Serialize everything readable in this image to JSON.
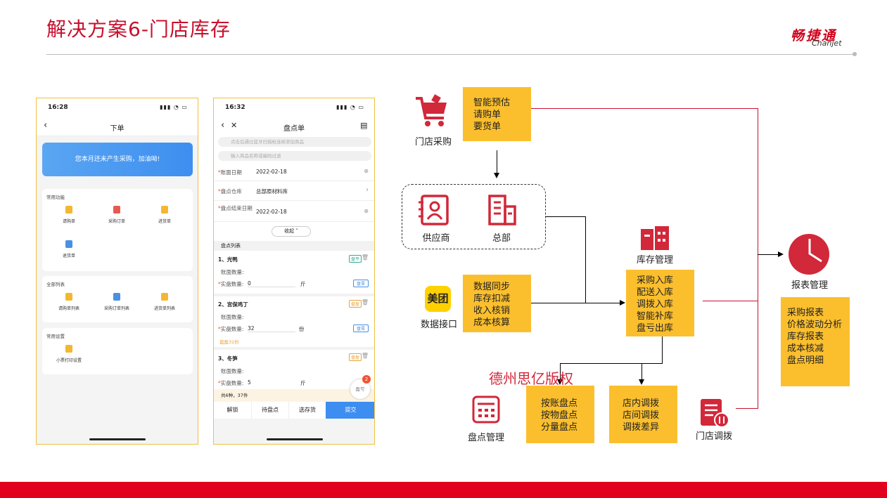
{
  "slide": {
    "title": "解决方案6-门店库存",
    "logo_cn": "畅捷通",
    "logo_en": "Chanjet",
    "watermark": "德州思亿版权"
  },
  "phone1": {
    "time": "16:28",
    "nav_title": "下单",
    "banner": "您本月还未产生采购，加油呦!",
    "sections": [
      {
        "title": "常用功能",
        "items": [
          "请购单",
          "采购订单",
          "进货单",
          "退货单"
        ]
      },
      {
        "title": "全部列表",
        "items": [
          "请购单列表",
          "采购订单列表",
          "进货单列表"
        ]
      },
      {
        "title": "常用设置",
        "items": [
          "小票打印设置"
        ]
      }
    ]
  },
  "phone2": {
    "time": "16:32",
    "nav_title": "盘点单",
    "search1": "点击后通过蓝牙扫描枪连续添加商品",
    "search2": "输入商品名称或编码过滤",
    "fields": [
      {
        "label": "账面日期",
        "value": "2022-02-18"
      },
      {
        "label": "盘点仓库",
        "value": "总部原材料库"
      },
      {
        "label": "盘点结束日期",
        "value": "2022-02-18"
      }
    ],
    "collapse": "收起",
    "list_title": "盘点列表",
    "items": [
      {
        "name": "1、光鸭",
        "book_label": "账面数量:",
        "actual_label": "实盘数量:",
        "actual": "0",
        "unit": "斤",
        "tag": "盘平",
        "btn": "盘零"
      },
      {
        "name": "2、宫保鸡丁",
        "book_label": "账面数量:",
        "actual_label": "实盘数量:",
        "actual": "32",
        "unit": "份",
        "tag": "盘盈",
        "btn": "盘零",
        "note": "盘盈32份"
      },
      {
        "name": "3、冬笋",
        "book_label": "账面数量:",
        "actual_label": "实盘数量:",
        "actual": "5",
        "unit": "斤",
        "tag": "盘盈"
      }
    ],
    "summary": "共6种，37件",
    "float_label": "盈亏",
    "badge": "2",
    "buttons": [
      "解锁",
      "待盘点",
      "选存货",
      "提交"
    ]
  },
  "diagram": {
    "store_purchase": {
      "label": "门店采购",
      "lines": [
        "智能预估",
        "请购单",
        "要货单"
      ]
    },
    "supplier": "供应商",
    "hq": "总部",
    "data_interface": {
      "label": "数据接口",
      "logo": "美团",
      "lines": [
        "数据同步",
        "库存扣减",
        "收入核销",
        "成本核算"
      ]
    },
    "inventory": {
      "label": "库存管理",
      "lines": [
        "采购入库",
        "配送入库",
        "调拨入库",
        "智能补库",
        "盘亏出库"
      ]
    },
    "report": {
      "label": "报表管理",
      "lines": [
        "采购报表",
        "价格波动分析",
        "库存报表",
        "成本核减",
        "盘点明细"
      ]
    },
    "stocktake": {
      "label": "盘点管理",
      "lines": [
        "按账盘点",
        "按物盘点",
        "分量盘点"
      ]
    },
    "transfer_box": {
      "lines": [
        "店内调拨",
        "店间调拨",
        "调拨差异"
      ]
    },
    "store_transfer": {
      "label": "门店调拨"
    }
  },
  "colors": {
    "brand_red": "#c8102e",
    "yellow": "#fbbf2e",
    "blue": "#3d8ef0"
  }
}
